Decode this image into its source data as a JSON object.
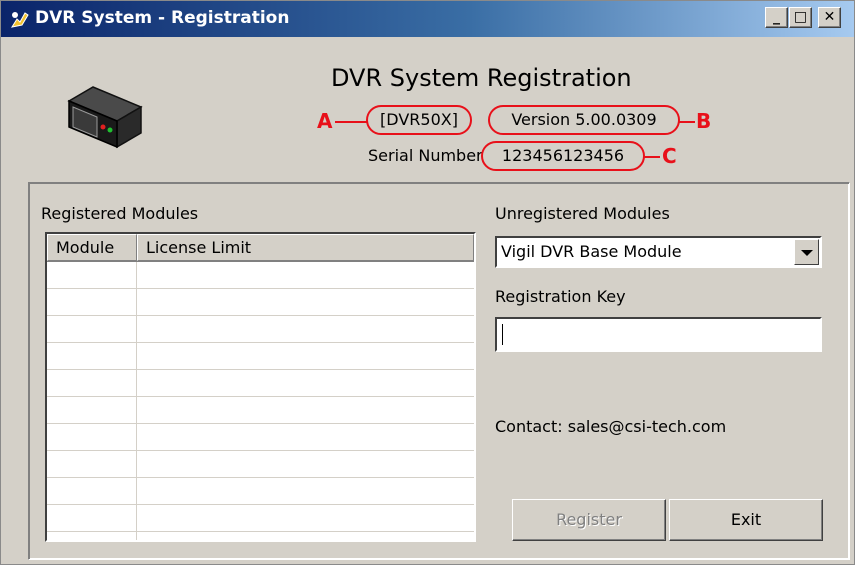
{
  "window": {
    "title": "DVR System - Registration",
    "controls": {
      "minimize": "_",
      "maximize": "□",
      "close": "✕"
    }
  },
  "header": {
    "title": "DVR System Registration",
    "model": "[DVR50X]",
    "version": "Version 5.00.0309",
    "serial_label": "Serial Number",
    "serial_value": "123456123456",
    "markers": {
      "a": "A",
      "b": "B",
      "c": "C"
    }
  },
  "registered": {
    "label": "Registered Modules",
    "columns": [
      "Module",
      "License Limit"
    ]
  },
  "unregistered": {
    "label": "Unregistered Modules",
    "selected": "Vigil DVR Base Module"
  },
  "registration_key": {
    "label": "Registration Key",
    "value": ""
  },
  "contact": "Contact: sales@csi-tech.com",
  "buttons": {
    "register": "Register",
    "exit": "Exit"
  },
  "colors": {
    "annotation": "#e8101a",
    "title_bar": "#0a246a",
    "disabled_text": "#808080"
  },
  "icons": {
    "app": "app-icon",
    "device": "dvr-device-icon",
    "dropdown": "chevron-down-icon"
  }
}
